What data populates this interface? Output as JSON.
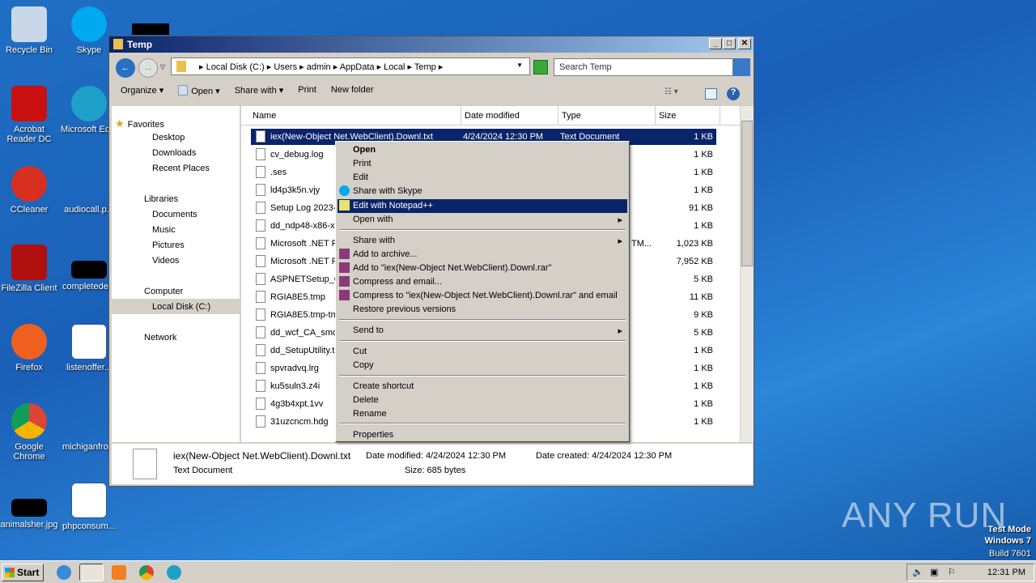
{
  "desktop": {
    "icons": [
      "Recycle Bin",
      "Skype",
      "Acrobat Reader DC",
      "Microsoft Ed...",
      "CCleaner",
      "audiocall.p...",
      "FileZilla Client",
      "completede...",
      "Firefox",
      "listenoffer...",
      "Google Chrome",
      "michiganfro...",
      "animalsher.jpg",
      "phpconsum..."
    ]
  },
  "window": {
    "title": "Temp",
    "address": [
      "Local Disk (C:)",
      "Users",
      "admin",
      "AppData",
      "Local",
      "Temp"
    ],
    "search_placeholder": "Search Temp"
  },
  "toolbar": {
    "organize": "Organize ▾",
    "open": "Open ▾",
    "share": "Share with ▾",
    "print": "Print",
    "new_folder": "New folder"
  },
  "nav": {
    "favorites": "Favorites",
    "desktop": "Desktop",
    "downloads": "Downloads",
    "recent": "Recent Places",
    "libraries": "Libraries",
    "documents": "Documents",
    "music": "Music",
    "pictures": "Pictures",
    "videos": "Videos",
    "computer": "Computer",
    "local_disk": "Local Disk (C:)",
    "network": "Network"
  },
  "columns": {
    "name": "Name",
    "date": "Date modified",
    "type": "Type",
    "size": "Size"
  },
  "files": [
    {
      "name": "iex(New-Object Net.WebClient).Downl.txt",
      "date": "4/24/2024 12:30 PM",
      "type": "Text Document",
      "size": "1 KB"
    },
    {
      "name": "cv_debug.log",
      "size": "1 KB"
    },
    {
      "name": ".ses",
      "size": "1 KB"
    },
    {
      "name": "ld4p3k5n.vjy",
      "size": "1 KB"
    },
    {
      "name": "Setup Log 2023-",
      "size": "91 KB"
    },
    {
      "name": "dd_ndp48-x86-x",
      "size": "1 KB"
    },
    {
      "name": "Microsoft .NET F",
      "type": "TM...",
      "size": "1,023 KB"
    },
    {
      "name": "Microsoft .NET F",
      "size": "7,952 KB"
    },
    {
      "name": "ASPNETSetup_0",
      "size": "5 KB"
    },
    {
      "name": "RGIA8E5.tmp",
      "size": "11 KB"
    },
    {
      "name": "RGIA8E5.tmp-tm",
      "size": "9 KB"
    },
    {
      "name": "dd_wcf_CA_smc",
      "size": "5 KB"
    },
    {
      "name": "dd_SetupUtility.t",
      "size": "1 KB"
    },
    {
      "name": "spvradvq.lrg",
      "size": "1 KB"
    },
    {
      "name": "ku5suln3.z4i",
      "size": "1 KB"
    },
    {
      "name": "4g3b4xpt.1vv",
      "size": "1 KB"
    },
    {
      "name": "31uzcncm.hdg",
      "size": "1 KB"
    }
  ],
  "details": {
    "name": "iex(New-Object Net.WebClient).Downl.txt",
    "type": "Text Document",
    "modified": "Date modified: 4/24/2024 12:30 PM",
    "created": "Date created: 4/24/2024 12:30 PM",
    "size": "Size: 685 bytes"
  },
  "menu": {
    "open": "Open",
    "print": "Print",
    "edit": "Edit",
    "skype": "Share with Skype",
    "npp": "Edit with Notepad++",
    "open_with": "Open with",
    "share_with": "Share with",
    "archive": "Add to archive...",
    "add_rar": "Add to \"iex(New-Object Net.WebClient).Downl.rar\"",
    "compress_email": "Compress and email...",
    "compress_rar_email": "Compress to \"iex(New-Object Net.WebClient).Downl.rar\" and email",
    "restore": "Restore previous versions",
    "send_to": "Send to",
    "cut": "Cut",
    "copy": "Copy",
    "shortcut": "Create shortcut",
    "delete": "Delete",
    "rename": "Rename",
    "properties": "Properties"
  },
  "taskbar": {
    "start": "Start",
    "clock": "12:31 PM"
  },
  "watermark": {
    "logo": "ANY RUN",
    "line1": "Test Mode",
    "line2": "Windows 7",
    "line3": "Build 7601"
  }
}
